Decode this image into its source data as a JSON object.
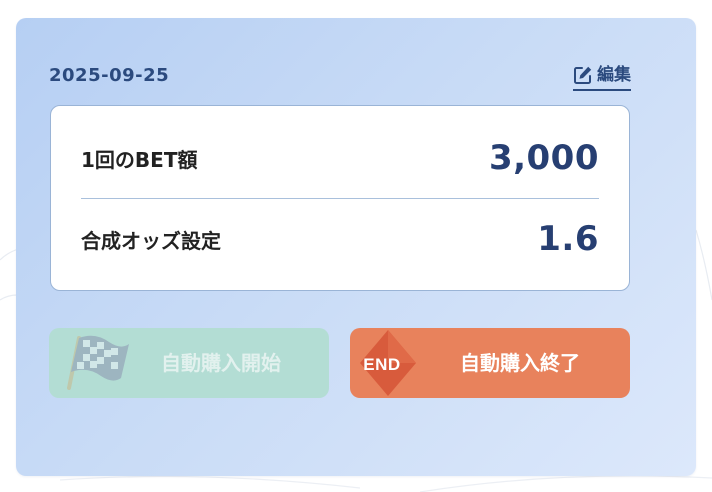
{
  "header": {
    "date": "2025-09-25",
    "edit_label": "編集"
  },
  "settings": {
    "bet_amount_label": "1回のBET額",
    "bet_amount_value": "3,000",
    "combined_odds_label": "合成オッズ設定",
    "combined_odds_value": "1.6"
  },
  "actions": {
    "start_label": "自動購入開始",
    "start_enabled": false,
    "end_label": "自動購入終了",
    "end_badge_text": "END",
    "end_enabled": true
  },
  "colors": {
    "accent_text": "#2b4a7e",
    "start_button": "#b3ddd4",
    "end_button": "#e8825c",
    "card_gradient_start": "#b6cff3",
    "card_gradient_end": "#dce8fb"
  },
  "icons": {
    "edit": "edit-icon",
    "start": "checkered-flag-icon",
    "end": "end-sign-icon"
  }
}
